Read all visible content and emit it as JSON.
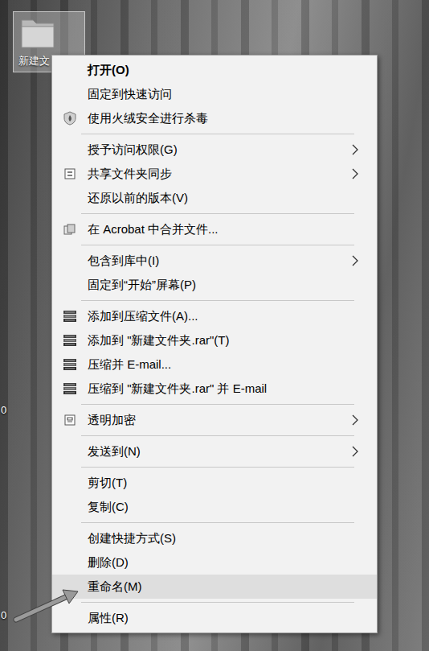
{
  "desktop": {
    "icons": [
      {
        "label": "新建文",
        "selected": true
      }
    ],
    "fragments": [
      "0",
      "0"
    ]
  },
  "context_menu": {
    "groups": [
      [
        {
          "label": "打开(O)",
          "kind": "plain",
          "default": true,
          "submenu": false,
          "selected": false
        },
        {
          "label": "固定到快速访问",
          "kind": "plain",
          "default": false,
          "submenu": false,
          "selected": false
        },
        {
          "label": "使用火绒安全进行杀毒",
          "kind": "shield",
          "default": false,
          "submenu": false,
          "selected": false
        }
      ],
      [
        {
          "label": "授予访问权限(G)",
          "kind": "plain",
          "default": false,
          "submenu": true,
          "selected": false
        },
        {
          "label": "共享文件夹同步",
          "kind": "sync",
          "default": false,
          "submenu": true,
          "selected": false
        },
        {
          "label": "还原以前的版本(V)",
          "kind": "plain",
          "default": false,
          "submenu": false,
          "selected": false
        }
      ],
      [
        {
          "label": "在 Acrobat 中合并文件...",
          "kind": "acrobat",
          "default": false,
          "submenu": false,
          "selected": false
        }
      ],
      [
        {
          "label": "包含到库中(I)",
          "kind": "plain",
          "default": false,
          "submenu": true,
          "selected": false
        },
        {
          "label": "固定到“开始”屏幕(P)",
          "kind": "plain",
          "default": false,
          "submenu": false,
          "selected": false
        }
      ],
      [
        {
          "label": "添加到压缩文件(A)...",
          "kind": "archive",
          "default": false,
          "submenu": false,
          "selected": false
        },
        {
          "label": "添加到 \"新建文件夹.rar\"(T)",
          "kind": "archive",
          "default": false,
          "submenu": false,
          "selected": false
        },
        {
          "label": "压缩并 E-mail...",
          "kind": "archive",
          "default": false,
          "submenu": false,
          "selected": false
        },
        {
          "label": "压缩到 \"新建文件夹.rar\" 并 E-mail",
          "kind": "archive",
          "default": false,
          "submenu": false,
          "selected": false
        }
      ],
      [
        {
          "label": "透明加密",
          "kind": "encrypt",
          "default": false,
          "submenu": true,
          "selected": false
        }
      ],
      [
        {
          "label": "发送到(N)",
          "kind": "plain",
          "default": false,
          "submenu": true,
          "selected": false
        }
      ],
      [
        {
          "label": "剪切(T)",
          "kind": "plain",
          "default": false,
          "submenu": false,
          "selected": false
        },
        {
          "label": "复制(C)",
          "kind": "plain",
          "default": false,
          "submenu": false,
          "selected": false
        }
      ],
      [
        {
          "label": "创建快捷方式(S)",
          "kind": "plain",
          "default": false,
          "submenu": false,
          "selected": false
        },
        {
          "label": "删除(D)",
          "kind": "plain",
          "default": false,
          "submenu": false,
          "selected": false
        },
        {
          "label": "重命名(M)",
          "kind": "plain",
          "default": false,
          "submenu": false,
          "selected": true
        }
      ],
      [
        {
          "label": "属性(R)",
          "kind": "plain",
          "default": false,
          "submenu": false,
          "selected": false
        }
      ]
    ]
  }
}
